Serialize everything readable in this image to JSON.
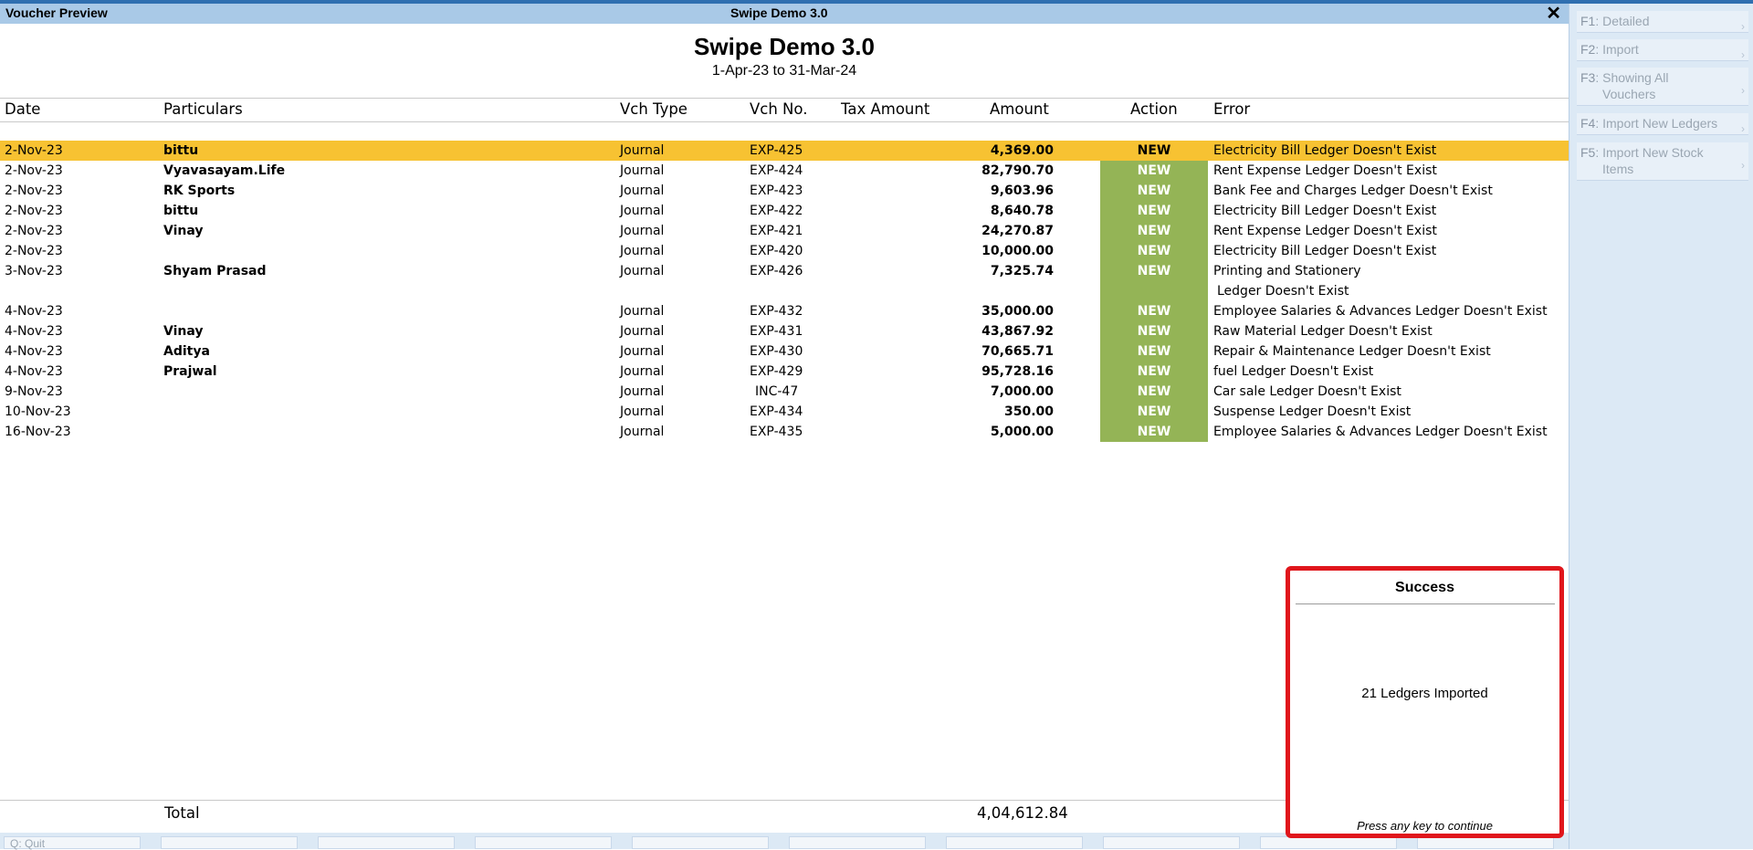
{
  "window": {
    "left_title": "Voucher Preview",
    "center_title": "Swipe Demo 3.0",
    "close_glyph": "✕"
  },
  "report": {
    "company": "Swipe Demo 3.0",
    "period": "1-Apr-23 to 31-Mar-24"
  },
  "columns": {
    "date": "Date",
    "particulars": "Particulars",
    "vch_type": "Vch Type",
    "vch_no": "Vch No.",
    "tax_amount": "Tax Amount",
    "amount": "Amount",
    "action": "Action",
    "error": "Error"
  },
  "rows": [
    {
      "date": "2-Nov-23",
      "particulars": "bittu",
      "vch_type": "Journal",
      "vch_no": "EXP-425",
      "amount": "4,369.00",
      "action": "NEW",
      "error": "Electricity Bill Ledger Doesn't Exist"
    },
    {
      "date": "2-Nov-23",
      "particulars": "Vyavasayam.Life",
      "vch_type": "Journal",
      "vch_no": "EXP-424",
      "amount": "82,790.70",
      "action": "NEW",
      "error": "Rent Expense Ledger Doesn't Exist"
    },
    {
      "date": "2-Nov-23",
      "particulars": "RK Sports",
      "vch_type": "Journal",
      "vch_no": "EXP-423",
      "amount": "9,603.96",
      "action": "NEW",
      "error": "Bank Fee and Charges Ledger Doesn't Exist"
    },
    {
      "date": "2-Nov-23",
      "particulars": "bittu",
      "vch_type": "Journal",
      "vch_no": "EXP-422",
      "amount": "8,640.78",
      "action": "NEW",
      "error": "Electricity Bill Ledger Doesn't Exist"
    },
    {
      "date": "2-Nov-23",
      "particulars": "Vinay",
      "vch_type": "Journal",
      "vch_no": "EXP-421",
      "amount": "24,270.87",
      "action": "NEW",
      "error": "Rent Expense Ledger Doesn't Exist"
    },
    {
      "date": "2-Nov-23",
      "particulars": "",
      "vch_type": "Journal",
      "vch_no": "EXP-420",
      "amount": "10,000.00",
      "action": "NEW",
      "error": "Electricity Bill Ledger Doesn't Exist"
    },
    {
      "date": "3-Nov-23",
      "particulars": "Shyam Prasad",
      "vch_type": "Journal",
      "vch_no": "EXP-426",
      "amount": "7,325.74",
      "action": "NEW",
      "error": "Printing and Stationery"
    },
    {
      "date": "4-Nov-23",
      "particulars": "",
      "vch_type": "Journal",
      "vch_no": "EXP-432",
      "amount": "35,000.00",
      "action": "NEW",
      "error": "Employee Salaries & Advances Ledger Doesn't Exist"
    },
    {
      "date": "4-Nov-23",
      "particulars": "Vinay",
      "vch_type": "Journal",
      "vch_no": "EXP-431",
      "amount": "43,867.92",
      "action": "NEW",
      "error": "Raw Material Ledger Doesn't Exist"
    },
    {
      "date": "4-Nov-23",
      "particulars": "Aditya",
      "vch_type": "Journal",
      "vch_no": "EXP-430",
      "amount": "70,665.71",
      "action": "NEW",
      "error": "Repair & Maintenance Ledger Doesn't Exist"
    },
    {
      "date": "4-Nov-23",
      "particulars": "Prajwal",
      "vch_type": "Journal",
      "vch_no": "EXP-429",
      "amount": "95,728.16",
      "action": "NEW",
      "error": "fuel Ledger Doesn't Exist"
    },
    {
      "date": "9-Nov-23",
      "particulars": "",
      "vch_type": "Journal",
      "vch_no": "INC-47",
      "amount": "7,000.00",
      "action": "NEW",
      "error": "Car sale Ledger Doesn't Exist"
    },
    {
      "date": "10-Nov-23",
      "particulars": "",
      "vch_type": "Journal",
      "vch_no": "EXP-434",
      "amount": "350.00",
      "action": "NEW",
      "error": "Suspense Ledger Doesn't Exist"
    },
    {
      "date": "16-Nov-23",
      "particulars": "",
      "vch_type": "Journal",
      "vch_no": "EXP-435",
      "amount": "5,000.00",
      "action": "NEW",
      "error": "Employee Salaries & Advances Ledger Doesn't Exist"
    }
  ],
  "row6_error_cont": "Ledger Doesn't Exist",
  "total": {
    "label": "Total",
    "value": "4,04,612.84"
  },
  "right_panel": [
    {
      "key": "F1",
      "label": "Detailed"
    },
    {
      "key": "F2",
      "label": "Import"
    },
    {
      "key": "F3",
      "label": "Showing All",
      "label2": "Vouchers"
    },
    {
      "key": "F4",
      "label": "Import New Ledgers"
    },
    {
      "key": "F5",
      "label": "Import New Stock",
      "label2": "Items"
    }
  ],
  "bottom": {
    "quit_key": "Q",
    "quit_label": "Quit"
  },
  "dialog": {
    "title": "Success",
    "message": "21 Ledgers Imported",
    "footer": "Press any key to continue"
  },
  "colors": {
    "selected_row": "#f7c232",
    "new_badge": "#94b456",
    "dialog_border": "#e0161c",
    "title_bar": "#a9c9e7"
  }
}
